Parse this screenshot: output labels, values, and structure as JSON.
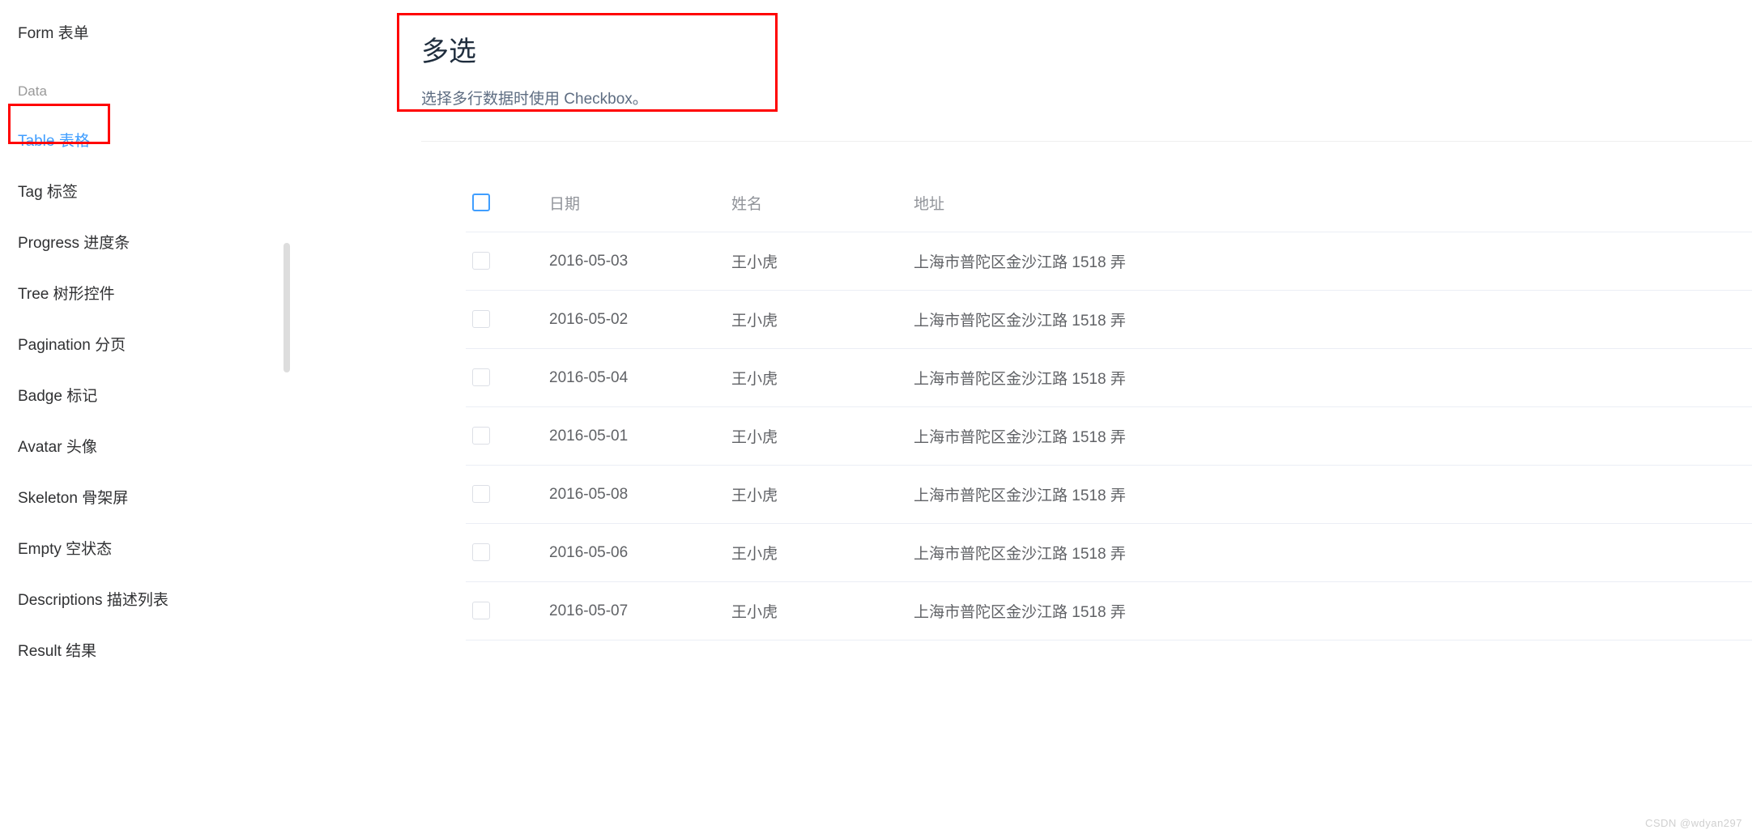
{
  "sidebar": {
    "top_item": "Form 表单",
    "section_label": "Data",
    "items": [
      "Table 表格",
      "Tag 标签",
      "Progress 进度条",
      "Tree 树形控件",
      "Pagination 分页",
      "Badge 标记",
      "Avatar 头像",
      "Skeleton 骨架屏",
      "Empty 空状态",
      "Descriptions 描述列表",
      "Result 结果"
    ],
    "active_index": 0
  },
  "main": {
    "title": "多选",
    "subtitle": "选择多行数据时使用 Checkbox。",
    "columns": {
      "date": "日期",
      "name": "姓名",
      "address": "地址"
    },
    "rows": [
      {
        "date": "2016-05-03",
        "name": "王小虎",
        "address": "上海市普陀区金沙江路 1518 弄"
      },
      {
        "date": "2016-05-02",
        "name": "王小虎",
        "address": "上海市普陀区金沙江路 1518 弄"
      },
      {
        "date": "2016-05-04",
        "name": "王小虎",
        "address": "上海市普陀区金沙江路 1518 弄"
      },
      {
        "date": "2016-05-01",
        "name": "王小虎",
        "address": "上海市普陀区金沙江路 1518 弄"
      },
      {
        "date": "2016-05-08",
        "name": "王小虎",
        "address": "上海市普陀区金沙江路 1518 弄"
      },
      {
        "date": "2016-05-06",
        "name": "王小虎",
        "address": "上海市普陀区金沙江路 1518 弄"
      },
      {
        "date": "2016-05-07",
        "name": "王小虎",
        "address": "上海市普陀区金沙江路 1518 弄"
      }
    ]
  },
  "watermark": "CSDN @wdyan297"
}
